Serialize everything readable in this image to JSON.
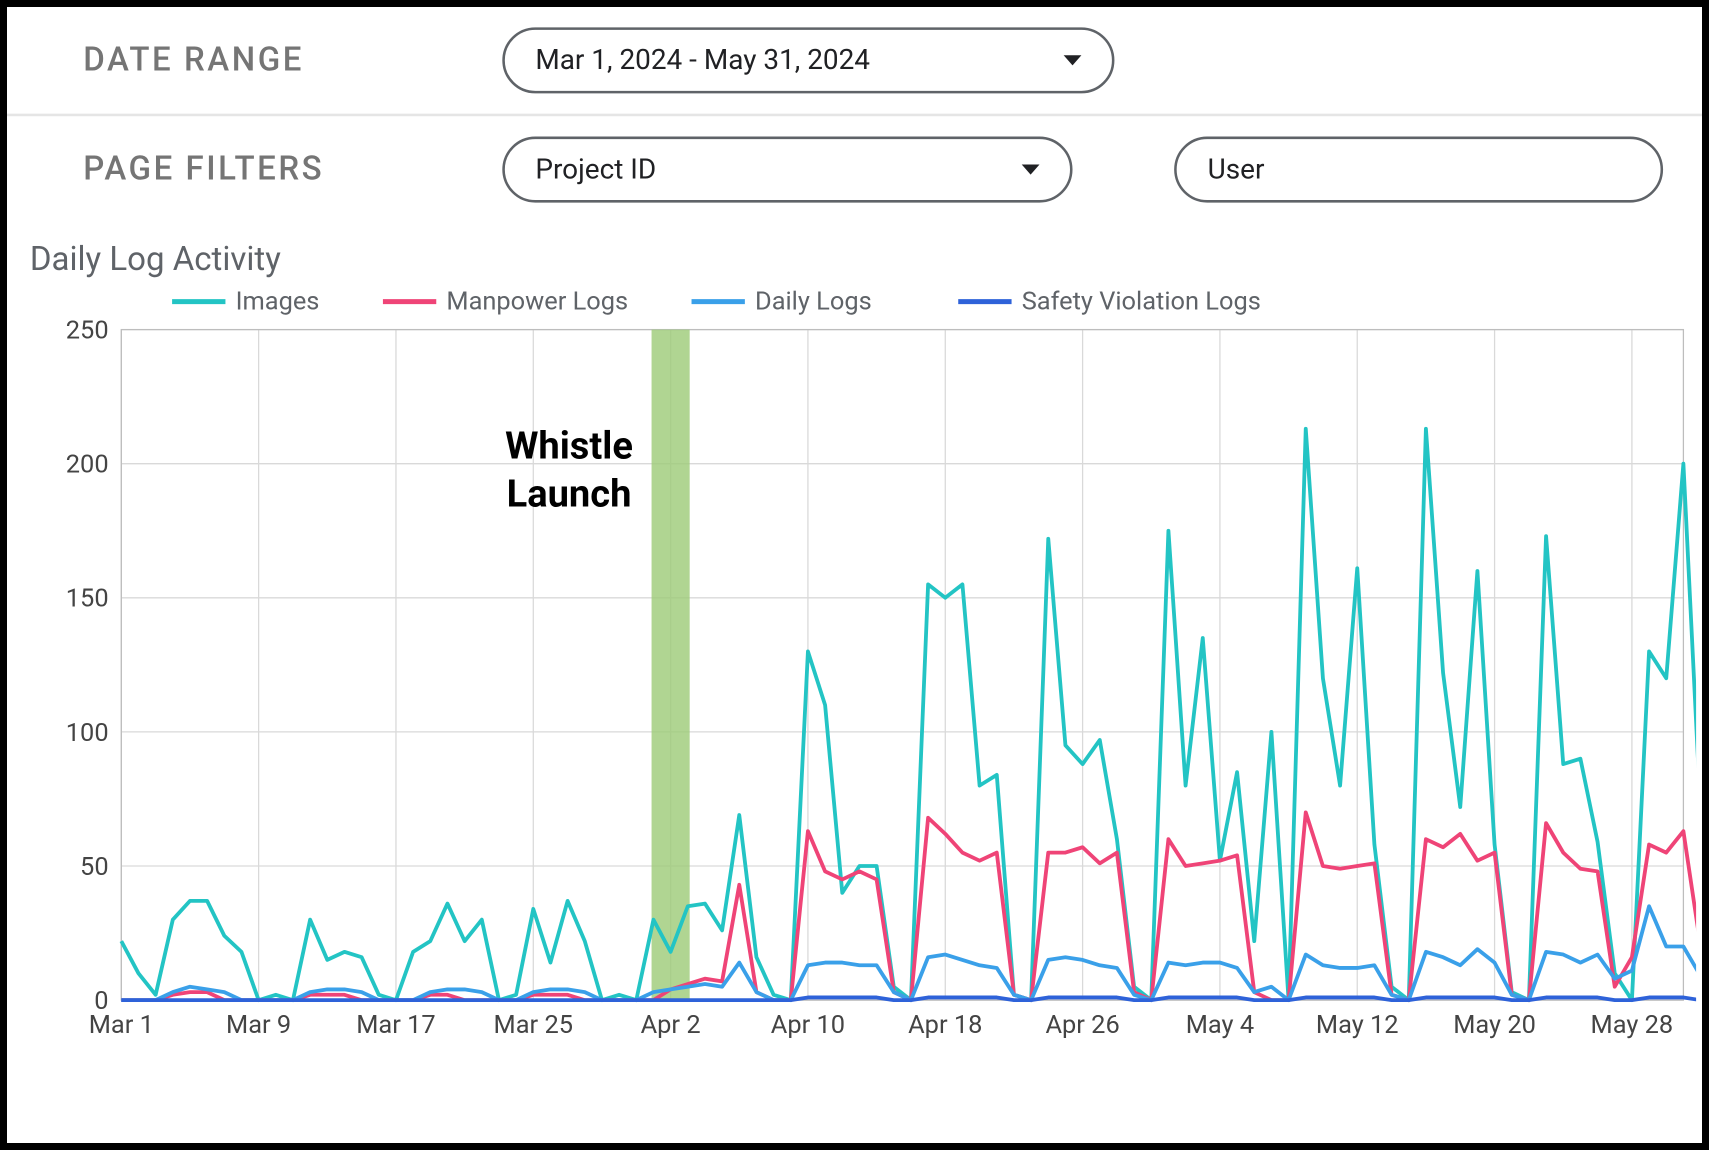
{
  "labels": {
    "date_range": "DATE RANGE",
    "page_filters": "PAGE FILTERS"
  },
  "dd": {
    "range": "Mar 1, 2024 - May 31, 2024",
    "project": "Project ID",
    "user": "User"
  },
  "chart_title": "Daily Log Activity",
  "annotation": {
    "line1": "Whistle",
    "line2": "Launch"
  },
  "chart_data": {
    "type": "line",
    "title": "Daily Log Activity",
    "xlabel": "",
    "ylabel": "",
    "ylim": [
      0,
      250
    ],
    "y_ticks": [
      0,
      50,
      100,
      150,
      200,
      250
    ],
    "x": [
      "Mar 1",
      "Mar 2",
      "Mar 3",
      "Mar 4",
      "Mar 5",
      "Mar 6",
      "Mar 7",
      "Mar 8",
      "Mar 9",
      "Mar 10",
      "Mar 11",
      "Mar 12",
      "Mar 13",
      "Mar 14",
      "Mar 15",
      "Mar 16",
      "Mar 17",
      "Mar 18",
      "Mar 19",
      "Mar 20",
      "Mar 21",
      "Mar 22",
      "Mar 23",
      "Mar 24",
      "Mar 25",
      "Mar 26",
      "Mar 27",
      "Mar 28",
      "Mar 29",
      "Mar 30",
      "Mar 31",
      "Apr 1",
      "Apr 2",
      "Apr 3",
      "Apr 4",
      "Apr 5",
      "Apr 6",
      "Apr 7",
      "Apr 8",
      "Apr 9",
      "Apr 10",
      "Apr 11",
      "Apr 12",
      "Apr 13",
      "Apr 14",
      "Apr 15",
      "Apr 16",
      "Apr 17",
      "Apr 18",
      "Apr 19",
      "Apr 20",
      "Apr 21",
      "Apr 22",
      "Apr 23",
      "Apr 24",
      "Apr 25",
      "Apr 26",
      "Apr 27",
      "Apr 28",
      "Apr 29",
      "Apr 30",
      "May 1",
      "May 2",
      "May 3",
      "May 4",
      "May 5",
      "May 6",
      "May 7",
      "May 8",
      "May 9",
      "May 10",
      "May 11",
      "May 12",
      "May 13",
      "May 14",
      "May 15",
      "May 16",
      "May 17",
      "May 18",
      "May 19",
      "May 20",
      "May 21",
      "May 22",
      "May 23",
      "May 24",
      "May 25",
      "May 26",
      "May 27",
      "May 28",
      "May 29",
      "May 30",
      "May 31"
    ],
    "x_ticks": [
      "Mar 1",
      "Mar 9",
      "Mar 17",
      "Mar 25",
      "Apr 2",
      "Apr 10",
      "Apr 18",
      "Apr 26",
      "May 4",
      "May 12",
      "May 20",
      "May 28"
    ],
    "series": [
      {
        "name": "Images",
        "color": "#23c4c4",
        "values": [
          22,
          10,
          2,
          30,
          37,
          37,
          24,
          18,
          0,
          2,
          0,
          30,
          15,
          18,
          16,
          2,
          0,
          18,
          22,
          36,
          22,
          30,
          0,
          2,
          34,
          14,
          37,
          22,
          0,
          2,
          0,
          30,
          18,
          35,
          36,
          26,
          69,
          16,
          2,
          0,
          130,
          110,
          40,
          50,
          50,
          5,
          0,
          155,
          150,
          155,
          80,
          84,
          2,
          0,
          172,
          95,
          88,
          97,
          60,
          5,
          0,
          175,
          80,
          135,
          52,
          85,
          22,
          100,
          0,
          213,
          120,
          80,
          161,
          58,
          5,
          0,
          213,
          122,
          72,
          160,
          58,
          3,
          0,
          173,
          88,
          90,
          59,
          10,
          0,
          130,
          120,
          200,
          70
        ]
      },
      {
        "name": "Manpower Logs",
        "color": "#ef4477",
        "values": [
          0,
          0,
          0,
          2,
          3,
          3,
          0,
          0,
          0,
          0,
          0,
          2,
          2,
          2,
          0,
          0,
          0,
          0,
          2,
          2,
          0,
          0,
          0,
          0,
          2,
          2,
          2,
          0,
          0,
          0,
          0,
          0,
          4,
          6,
          8,
          7,
          43,
          3,
          0,
          0,
          63,
          48,
          45,
          48,
          45,
          3,
          0,
          68,
          62,
          55,
          52,
          55,
          2,
          0,
          55,
          55,
          57,
          51,
          55,
          3,
          0,
          60,
          50,
          51,
          52,
          54,
          3,
          0,
          0,
          70,
          50,
          49,
          50,
          51,
          2,
          0,
          60,
          57,
          62,
          52,
          55,
          2,
          0,
          66,
          55,
          49,
          48,
          5,
          16,
          58,
          55,
          63,
          20
        ]
      },
      {
        "name": "Daily Logs",
        "color": "#3aa0e9",
        "values": [
          0,
          0,
          0,
          3,
          5,
          4,
          3,
          0,
          0,
          0,
          0,
          3,
          4,
          4,
          3,
          0,
          0,
          0,
          3,
          4,
          4,
          3,
          0,
          0,
          3,
          4,
          4,
          3,
          0,
          0,
          0,
          3,
          4,
          5,
          6,
          5,
          14,
          3,
          0,
          0,
          13,
          14,
          14,
          13,
          13,
          3,
          0,
          16,
          17,
          15,
          13,
          12,
          2,
          0,
          15,
          16,
          15,
          13,
          12,
          2,
          0,
          14,
          13,
          14,
          14,
          12,
          3,
          5,
          0,
          17,
          13,
          12,
          12,
          13,
          2,
          0,
          18,
          16,
          13,
          19,
          14,
          2,
          0,
          18,
          17,
          14,
          17,
          8,
          11,
          35,
          20,
          20,
          9
        ]
      },
      {
        "name": "Safety Violation Logs",
        "color": "#2e62d9",
        "values": [
          0,
          0,
          0,
          0,
          0,
          0,
          0,
          0,
          0,
          0,
          0,
          0,
          0,
          0,
          0,
          0,
          0,
          0,
          0,
          0,
          0,
          0,
          0,
          0,
          0,
          0,
          0,
          0,
          0,
          0,
          0,
          0,
          0,
          0,
          0,
          0,
          0,
          0,
          0,
          0,
          1,
          1,
          1,
          1,
          1,
          0,
          0,
          1,
          1,
          1,
          1,
          1,
          0,
          0,
          1,
          1,
          1,
          1,
          1,
          0,
          0,
          1,
          1,
          1,
          1,
          1,
          0,
          0,
          0,
          1,
          1,
          1,
          1,
          1,
          0,
          0,
          1,
          1,
          1,
          1,
          1,
          0,
          0,
          1,
          1,
          1,
          1,
          0,
          0,
          1,
          1,
          1,
          0
        ]
      }
    ],
    "annotation": {
      "x": "Apr 2",
      "text": "Whistle Launch"
    }
  }
}
